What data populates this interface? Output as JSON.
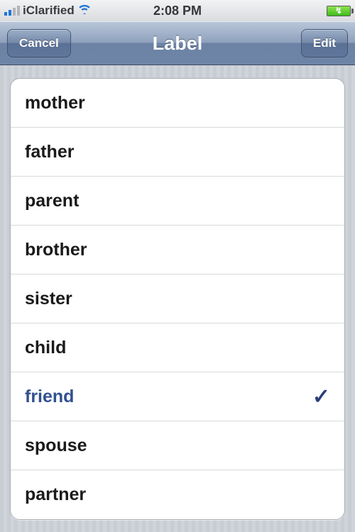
{
  "status": {
    "carrier": "iClarified",
    "time": "2:08 PM"
  },
  "nav": {
    "cancel": "Cancel",
    "title": "Label",
    "edit": "Edit"
  },
  "labels": {
    "items": [
      {
        "text": "mother",
        "selected": false
      },
      {
        "text": "father",
        "selected": false
      },
      {
        "text": "parent",
        "selected": false
      },
      {
        "text": "brother",
        "selected": false
      },
      {
        "text": "sister",
        "selected": false
      },
      {
        "text": "child",
        "selected": false
      },
      {
        "text": "friend",
        "selected": true
      },
      {
        "text": "spouse",
        "selected": false
      },
      {
        "text": "partner",
        "selected": false
      }
    ]
  }
}
